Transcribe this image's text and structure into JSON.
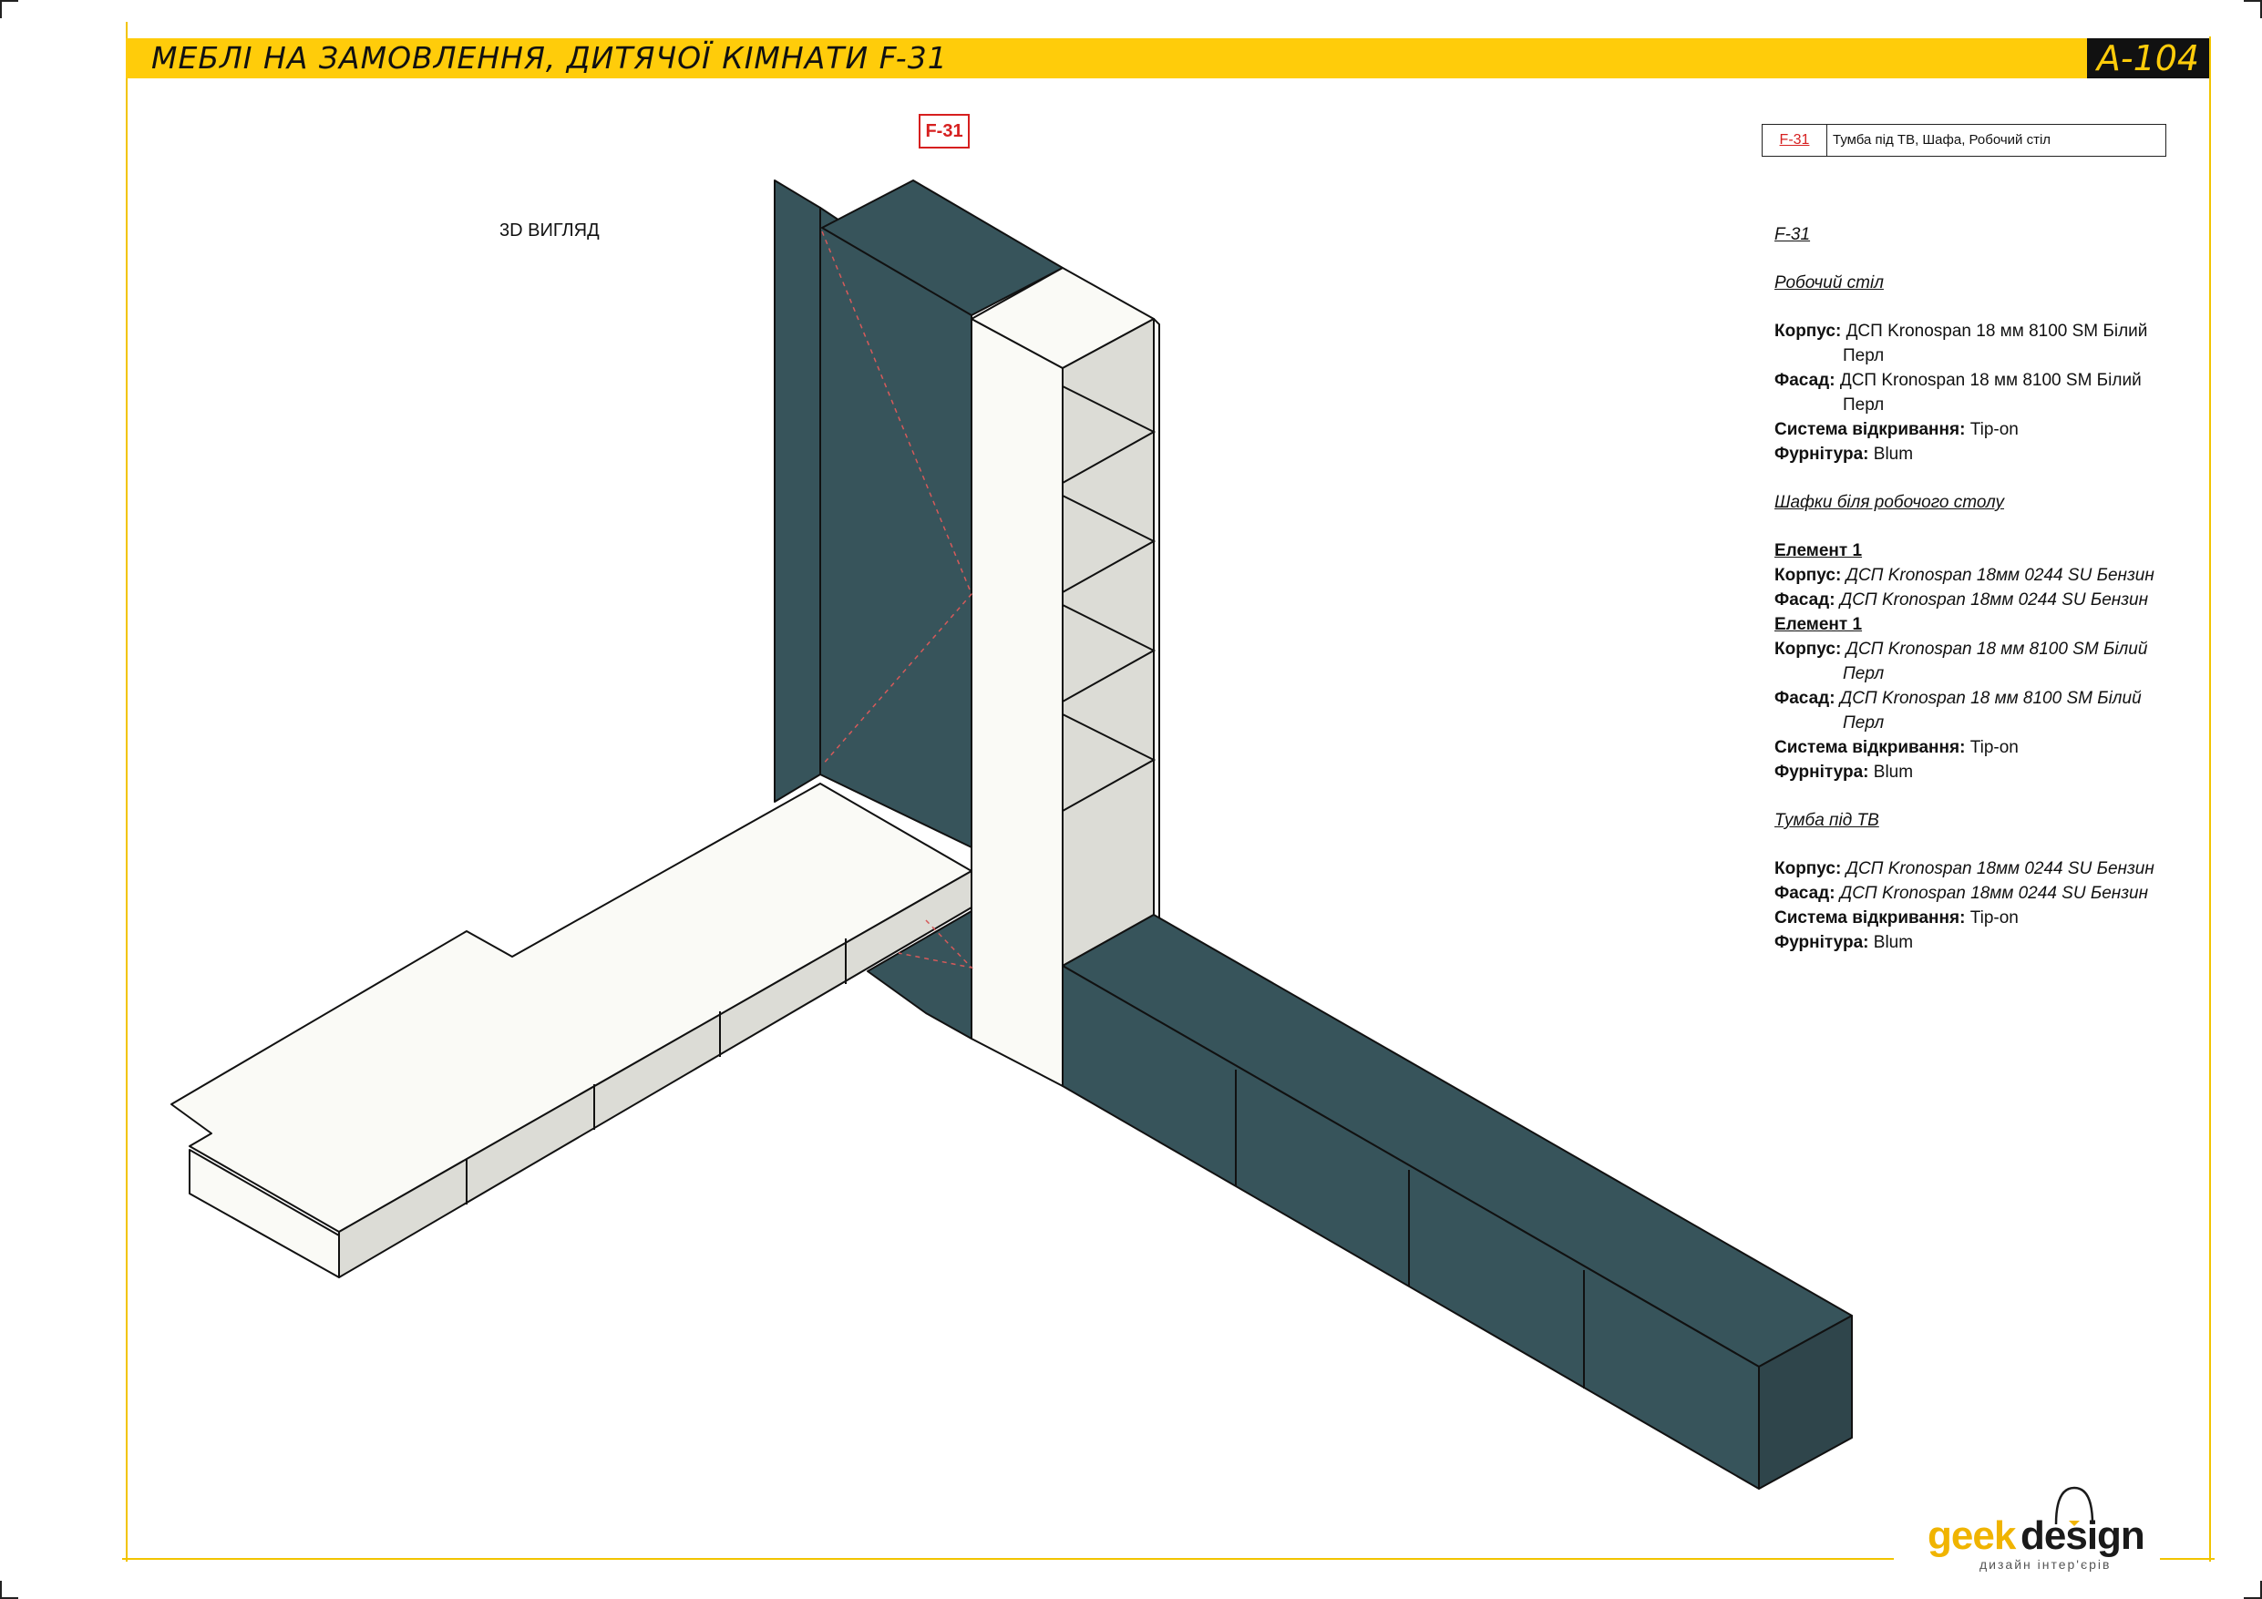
{
  "header": {
    "title": "МЕБЛІ НА ЗАМОВЛЕННЯ, ДИТЯЧОЇ КІМНАТИ F-31",
    "sheet_number": "A-104"
  },
  "drawing": {
    "tag": "F-31",
    "view_label": "3D ВИГЛЯД",
    "colors": {
      "panel_dark": "#37545b",
      "panel_light": "#fafaf6",
      "panel_shade": "#dcdcd6",
      "accent_line": "#d65a5a"
    }
  },
  "legend": {
    "code": "F-31",
    "description": "Тумба під ТВ, Шафа, Робочий стіл"
  },
  "spec": {
    "code": "F-31",
    "desk": {
      "title": "Робочий стіл",
      "body_label": "Корпус:",
      "body_value": "ДСП Kronospan 18 мм 8100 SM Білий Перл",
      "facade_label": "Фасад:",
      "facade_value": "ДСП Kronospan 18 мм 8100 SM Білий Перл",
      "opening_label": "Система відкривання:",
      "opening_value": "Tip-on",
      "hardware_label": "Фурнітура:",
      "hardware_value": "Blum"
    },
    "cabinets": {
      "title": "Шафки біля робочого столу",
      "element1_title": "Елемент 1",
      "el1_body_label": "Корпус:",
      "el1_body_value": "ДСП Kronospan 18мм  0244 SU Бензин",
      "el1_facade_label": "Фасад:",
      "el1_facade_value": "ДСП Kronospan 18мм  0244 SU Бензин",
      "element2_title": "Елемент 1",
      "el2_body_label": "Корпус:",
      "el2_body_value": "ДСП Kronospan 18 мм 8100 SM Білий Перл",
      "el2_facade_label": "Фасад:",
      "el2_facade_value": "ДСП Kronospan 18 мм 8100 SM Білий Перл",
      "opening_label": "Система відкривання:",
      "opening_value": "Tip-on",
      "hardware_label": "Фурнітура:",
      "hardware_value": "Blum"
    },
    "tv": {
      "title": "Тумба під ТВ",
      "body_label": "Корпус:",
      "body_value": "ДСП Kronospan 18мм  0244 SU Бензин",
      "facade_label": "Фасад:",
      "facade_value": "ДСП Kronospan 18мм  0244 SU Бензин",
      "opening_label": "Система відкривання:",
      "opening_value": "Tip-on",
      "hardware_label": "Фурнітура:",
      "hardware_value": "Blum"
    }
  },
  "logo": {
    "geek": "geek",
    "design": "design",
    "subtitle": "дизайн інтер'єрів"
  }
}
